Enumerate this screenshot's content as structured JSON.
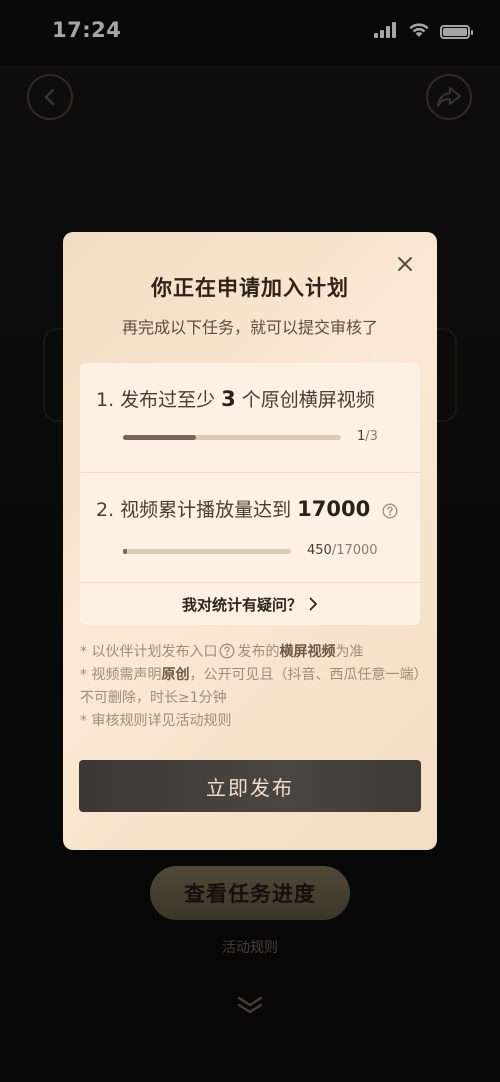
{
  "status_bar": {
    "time": "17:24",
    "icons": [
      "signal-icon",
      "wifi-icon",
      "battery-icon"
    ]
  },
  "background": {
    "back_icon": "chevron-left-icon",
    "share_icon": "share-arrow-icon",
    "progress_button_label": "查看任务进度",
    "rules_link_label": "活动规则",
    "scroll_icon": "double-chevron-down-icon"
  },
  "modal": {
    "close_icon": "close-icon",
    "title": "你正在申请加入计划",
    "subtitle": "再完成以下任务，就可以提交审核了",
    "tasks": [
      {
        "prefix": "1. 发布过至少",
        "number": "3",
        "suffix": "个原创横屏视频",
        "progress_current": "1",
        "progress_total": "/3",
        "progress_fraction": 0.333
      },
      {
        "prefix": "2. 视频累计播放量达到",
        "number": "17000",
        "suffix": "",
        "progress_current": "450",
        "progress_total": "/17000",
        "progress_fraction": 0.026
      }
    ],
    "stats_question_label": "我对统计有疑问？",
    "notes": {
      "note1_a": "* 以伙伴计划发布入口",
      "note1_b": "发布的",
      "note1_bold": "横屏视频",
      "note1_c": "为准",
      "note2_a": "* 视频需声明",
      "note2_bold": "原创",
      "note2_b": "，公开可见且（抖音、西瓜任意一端）不可删除，时长≥1分钟",
      "note3": "* 审核规则详见活动规则"
    },
    "publish_button_label": "立即发布"
  }
}
